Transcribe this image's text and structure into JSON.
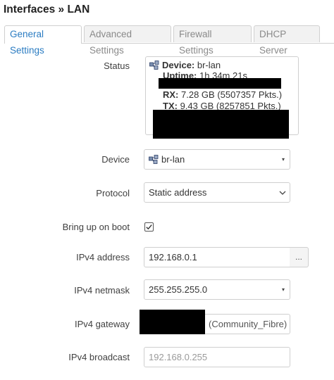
{
  "page": {
    "title": "Interfaces » LAN"
  },
  "tabs": [
    {
      "label": "General Settings",
      "active": true
    },
    {
      "label": "Advanced Settings"
    },
    {
      "label": "Firewall Settings"
    },
    {
      "label": "DHCP Server"
    }
  ],
  "status": {
    "label": "Status",
    "device_key": "Device:",
    "device_value": "br-lan",
    "uptime_key": "Uptime:",
    "uptime_value": "1h 34m 21s",
    "rx_key": "RX:",
    "rx_value": "7.28 GB (5507357 Pkts.)",
    "tx_key": "TX:",
    "tx_value": "9.43 GB (8257851 Pkts.)"
  },
  "device": {
    "label": "Device",
    "value": "br-lan"
  },
  "protocol": {
    "label": "Protocol",
    "value": "Static address"
  },
  "boot": {
    "label": "Bring up on boot",
    "checked": true
  },
  "ipv4_address": {
    "label": "IPv4 address",
    "value": "192.168.0.1",
    "button": "..."
  },
  "ipv4_netmask": {
    "label": "IPv4 netmask",
    "value": "255.255.255.0"
  },
  "ipv4_gateway": {
    "label": "IPv4 gateway",
    "hint": "(Community_Fibre)"
  },
  "ipv4_broadcast": {
    "label": "IPv4 broadcast",
    "placeholder": "192.168.0.255"
  },
  "icons": {
    "caret": "▾"
  }
}
